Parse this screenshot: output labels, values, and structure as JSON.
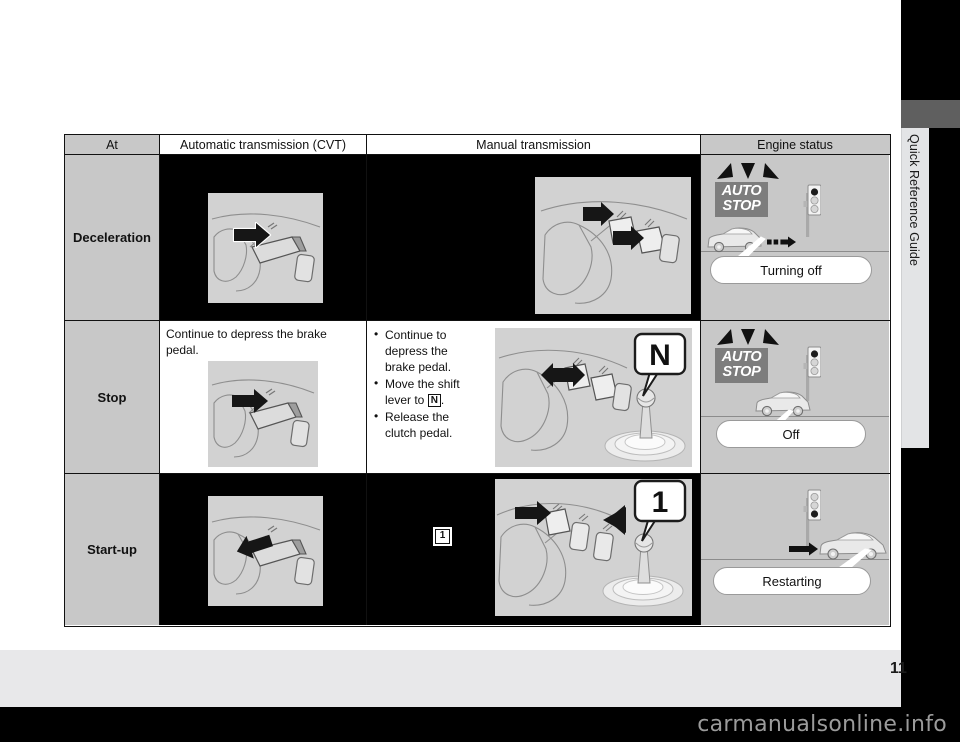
{
  "document": {
    "side_tab_label": "Quick Reference Guide",
    "page_number": "11",
    "watermark": "carmanualsonline.info"
  },
  "table": {
    "headers": {
      "at": "At",
      "cvt": "Automatic transmission (CVT)",
      "mt": "Manual transmission",
      "engine": "Engine status"
    },
    "rows": [
      {
        "at": "Deceleration",
        "cvt_text": "",
        "mt_text": "",
        "mt_bullets": [],
        "engine_indicator": "AUTO STOP",
        "engine_callout": "Turning off",
        "traffic_light": "red",
        "shift_badge": "",
        "marker": ""
      },
      {
        "at": "Stop",
        "cvt_text": "Continue to depress the brake pedal.",
        "mt_bullets": [
          {
            "pre": "Continue to depress the brake pedal.",
            "box": "",
            "post": ""
          },
          {
            "pre": "Move the shift lever to ",
            "box": "N",
            "post": "."
          },
          {
            "pre": "Release the clutch pedal.",
            "box": "",
            "post": ""
          }
        ],
        "engine_indicator": "AUTO STOP",
        "engine_callout": "Off",
        "traffic_light": "red",
        "shift_badge": "N",
        "marker": ""
      },
      {
        "at": "Start-up",
        "cvt_text": "",
        "mt_bullets": [],
        "engine_indicator": "",
        "engine_callout": "Restarting",
        "traffic_light": "green",
        "shift_badge": "1",
        "marker": "1"
      }
    ]
  },
  "colors": {
    "header_gray": "#c8c8c8",
    "cell_black": "#000000",
    "illustration_gray": "#d2d2d2",
    "autostop_badge": "#7d7d7d",
    "page_background": "#e8e8ea"
  }
}
